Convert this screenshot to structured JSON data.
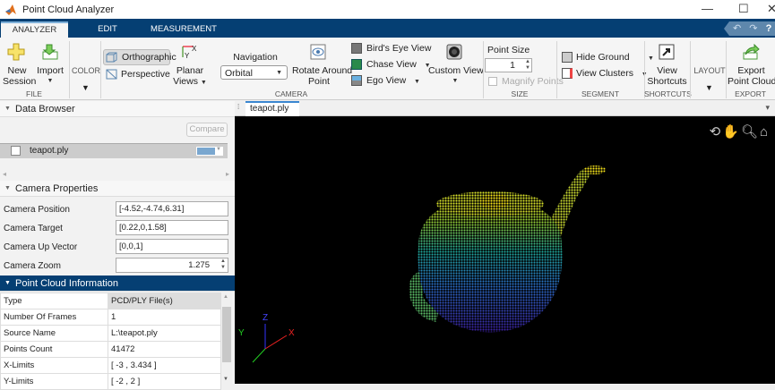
{
  "window": {
    "title": "Point Cloud Analyzer",
    "minimize": "—",
    "maximize": "☐",
    "close": "✕"
  },
  "tabs": [
    {
      "label": "ANALYZER",
      "active": true
    },
    {
      "label": "EDIT"
    },
    {
      "label": "MEASUREMENT"
    }
  ],
  "quick_access": {
    "undo": "↶",
    "redo": "↷",
    "help": "?"
  },
  "ribbon": {
    "file": {
      "new_session": [
        "New",
        "Session"
      ],
      "import": "Import",
      "group": "FILE"
    },
    "color": {
      "label": "COLOR"
    },
    "camera": {
      "orthographic": "Orthographic",
      "perspective": "Perspective",
      "planar_views": [
        "Planar",
        "Views"
      ],
      "navigation_label": "Navigation",
      "navigation_value": "Orbital",
      "rotate_around_point": [
        "Rotate Around",
        "Point"
      ],
      "birds_eye_view": "Bird's Eye View",
      "chase_view": "Chase View",
      "ego_view": "Ego View",
      "custom_view": "Custom View",
      "group": "CAMERA"
    },
    "size": {
      "point_size_label": "Point Size",
      "point_size_value": "1",
      "magnify_points": "Magnify Points",
      "magnify_checked": false,
      "group": "SIZE"
    },
    "segment": {
      "hide_ground": "Hide Ground",
      "view_clusters": "View Clusters",
      "group": "SEGMENT"
    },
    "shortcuts": {
      "view_shortcuts": [
        "View",
        "Shortcuts"
      ],
      "group": "SHORTCUTS"
    },
    "layout": {
      "label": "LAYOUT"
    },
    "export": {
      "export_point_cloud": [
        "Export",
        "Point Cloud"
      ],
      "group": "EXPORT"
    }
  },
  "data_browser": {
    "title": "Data Browser",
    "compare": "Compare",
    "items": [
      {
        "name": "teapot.ply",
        "checked": false,
        "color": "#7aa7cf"
      }
    ]
  },
  "camera_properties": {
    "title": "Camera Properties",
    "position_label": "Camera Position",
    "position": "[-4.52,-4.74,6.31]",
    "target_label": "Camera Target",
    "target": "[0.22,0,1.58]",
    "up_label": "Camera Up Vector",
    "up": "[0,0,1]",
    "zoom_label": "Camera Zoom",
    "zoom": "1.275"
  },
  "point_cloud_info": {
    "title": "Point Cloud Information",
    "rows": [
      [
        "Type",
        "PCD/PLY File(s)"
      ],
      [
        "Number Of Frames",
        "1"
      ],
      [
        "Source Name",
        "L:\\teapot.ply"
      ],
      [
        "Points Count",
        "41472"
      ],
      [
        "X-Limits",
        "[ -3 , 3.434 ]"
      ],
      [
        "Y-Limits",
        "[ -2 , 2 ]"
      ]
    ]
  },
  "viewer": {
    "tab": "teapot.ply",
    "axes": {
      "x": "X",
      "y": "Y",
      "z": "Z"
    },
    "colors": {
      "low": "#3b1fa0",
      "mid": "#1fa89a",
      "high": "#f5e21a"
    }
  }
}
